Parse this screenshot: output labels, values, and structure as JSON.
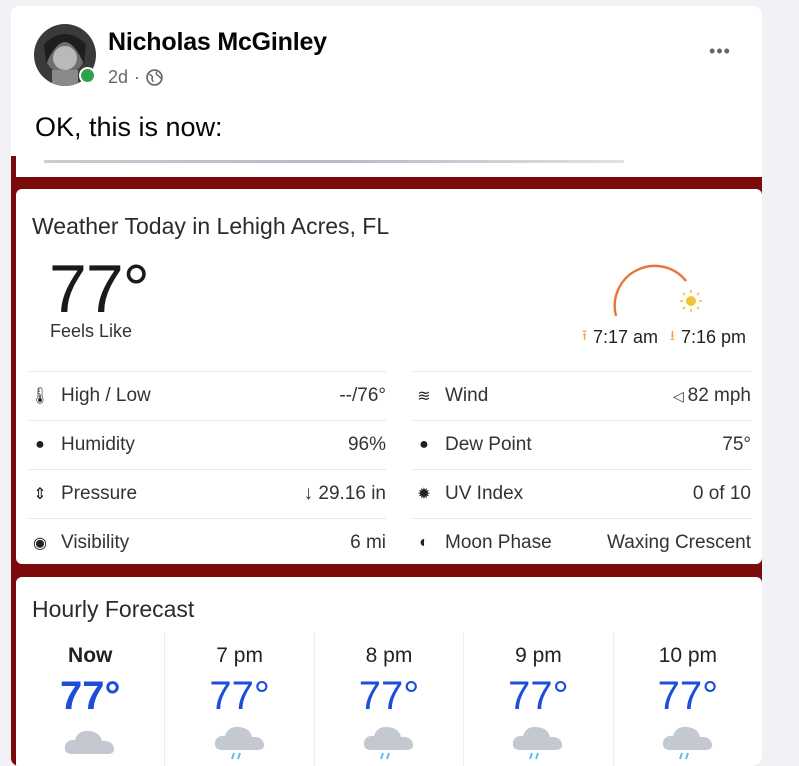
{
  "post": {
    "author": "Nicholas McGinley",
    "time": "2d",
    "separator": "·",
    "more_label": "•••",
    "text": "OK, this is now:"
  },
  "weather": {
    "title": "Weather Today in Lehigh Acres, FL",
    "temp": "77°",
    "feels_like": "Feels Like",
    "sunrise": "7:17 am",
    "sunset": "7:16 pm",
    "details_left": [
      {
        "label": "High / Low",
        "value": "--/76°",
        "icon": "thermometer-icon"
      },
      {
        "label": "Humidity",
        "value": "96%",
        "icon": "drop-icon"
      },
      {
        "label": "Pressure",
        "value": "29.16 in",
        "icon": "pressure-icon"
      },
      {
        "label": "Visibility",
        "value": "6 mi",
        "icon": "eye-icon"
      }
    ],
    "details_right": [
      {
        "label": "Wind",
        "value": "82 mph",
        "icon": "wind-icon"
      },
      {
        "label": "Dew Point",
        "value": "75°",
        "icon": "dewpoint-icon"
      },
      {
        "label": "UV Index",
        "value": "0 of 10",
        "icon": "sun-icon"
      },
      {
        "label": "Moon Phase",
        "value": "Waxing Crescent",
        "icon": "moon-icon"
      }
    ]
  },
  "hourly": {
    "title": "Hourly Forecast",
    "hours": [
      {
        "time": "Now",
        "temp": "77°"
      },
      {
        "time": "7 pm",
        "temp": "77°"
      },
      {
        "time": "8 pm",
        "temp": "77°"
      },
      {
        "time": "9 pm",
        "temp": "77°"
      },
      {
        "time": "10 pm",
        "temp": "77°"
      }
    ]
  },
  "colors": {
    "accent_red": "#7b0a0a",
    "temp_blue": "#1d4ed8",
    "online_green": "#31a24c",
    "sun_orange": "#f3a63b"
  }
}
